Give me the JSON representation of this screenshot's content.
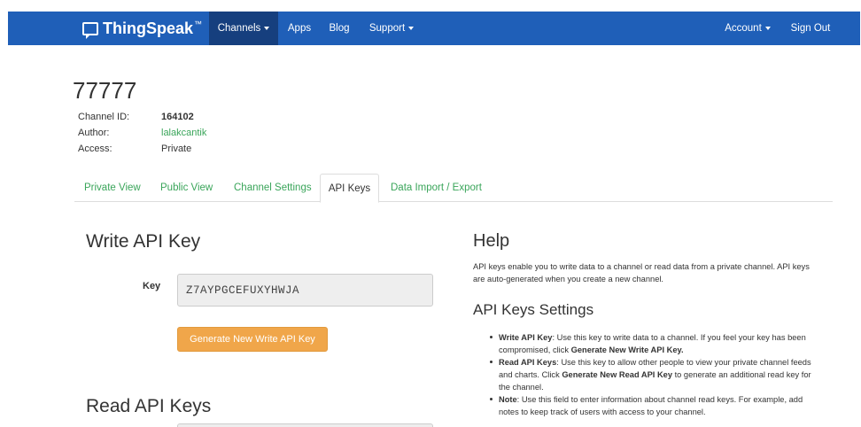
{
  "navbar": {
    "brand": "ThingSpeak",
    "brand_tm": "™",
    "items": [
      {
        "label": "Channels",
        "dropdown": true
      },
      {
        "label": "Apps"
      },
      {
        "label": "Blog"
      },
      {
        "label": "Support",
        "dropdown": true
      }
    ],
    "account": "Account",
    "signout": "Sign Out",
    "color": "#1f5fb8",
    "active_color": "#163f7e"
  },
  "channel": {
    "name": "77777",
    "id_label": "Channel ID:",
    "id_value": "164102",
    "author_label": "Author:",
    "author_value": "lalakcantik",
    "access_label": "Access:",
    "access_value": "Private"
  },
  "tabs": [
    "Private View",
    "Public View",
    "Channel Settings",
    "API Keys",
    "Data Import / Export"
  ],
  "write": {
    "heading": "Write API Key",
    "key_label": "Key",
    "key_value": "Z7AYPGCEFUXYHWJA",
    "button": "Generate New Write API Key",
    "button_color": "#f0a64a"
  },
  "read": {
    "heading": "Read API Keys"
  },
  "help": {
    "heading": "Help",
    "text": "API keys enable you to write data to a channel or read data from a private channel. API keys are auto-generated when you create a new channel.",
    "settings_heading": "API Keys Settings",
    "items": [
      {
        "term": "Write API Key",
        "text_a": ": Use this key to write data to a channel. If you feel your key has been compromised, click ",
        "bold": "Generate New Write API Key.",
        "text_b": ""
      },
      {
        "term": "Read API Keys",
        "text_a": ": Use this key to allow other people to view your private channel feeds and charts. Click ",
        "bold": "Generate New Read API Key",
        "text_b": " to generate an additional read key for the channel."
      },
      {
        "term": "Note",
        "text_a": ": Use this field to enter information about channel read keys. For example, add notes to keep track of users with access to your channel.",
        "bold": "",
        "text_b": ""
      }
    ]
  },
  "link_color": "#3aa55a"
}
